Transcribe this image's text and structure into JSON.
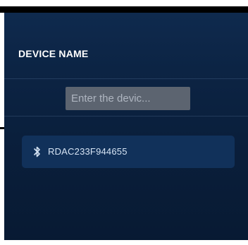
{
  "header": {
    "title": "DEVICE NAME"
  },
  "search": {
    "placeholder": "Enter the devic...",
    "value": ""
  },
  "devices": [
    {
      "name": "RDAC233F944655",
      "icon": "bluetooth-icon"
    }
  ],
  "colors": {
    "background_top": "#0f2a4e",
    "background_bottom": "#081a33",
    "card": "#11315a",
    "input": "#5c6470",
    "title_text": "#ffffff",
    "device_text": "#d6e4f4"
  }
}
